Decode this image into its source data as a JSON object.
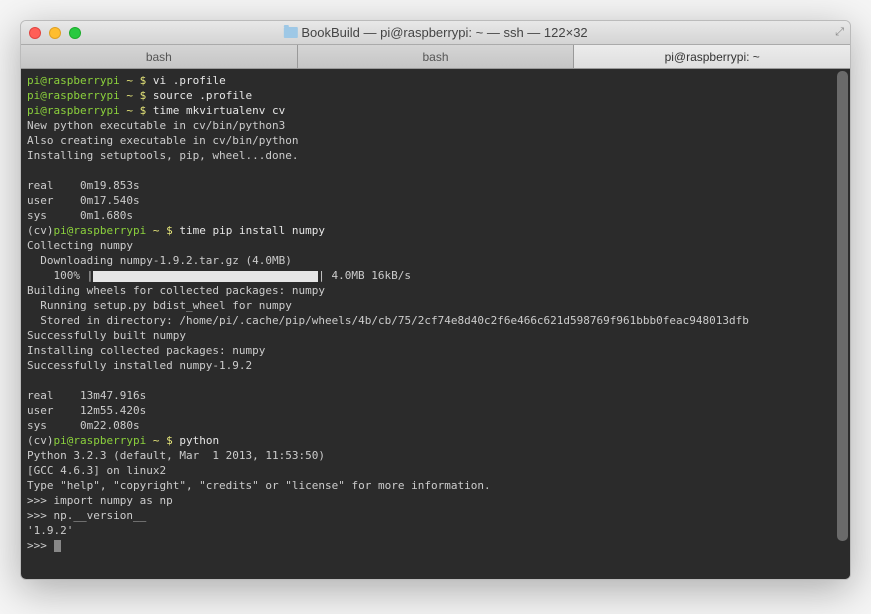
{
  "window": {
    "title": "BookBuild — pi@raspberrypi: ~ — ssh — 122×32"
  },
  "tabs": [
    {
      "label": "bash"
    },
    {
      "label": "bash"
    },
    {
      "label": "pi@raspberrypi: ~"
    }
  ],
  "prompt": {
    "user": "pi@raspberrypi",
    "path": " ~ $ ",
    "venv": "(cv)"
  },
  "cmds": {
    "l1": "vi .profile",
    "l2": "source .profile",
    "l3": "time mkvirtualenv cv",
    "l4": "time pip install numpy",
    "l5": "python"
  },
  "out": {
    "a1": "New python executable in cv/bin/python3",
    "a2": "Also creating executable in cv/bin/python",
    "a3": "Installing setuptools, pip, wheel...done.",
    "t1a": "real    0m19.853s",
    "t1b": "user    0m17.540s",
    "t1c": "sys     0m1.680s",
    "b1": "Collecting numpy",
    "b2": "  Downloading numpy-1.9.2.tar.gz (4.0MB)",
    "b3a": "    100% |",
    "b3b": "| 4.0MB 16kB/s",
    "b4": "Building wheels for collected packages: numpy",
    "b5": "  Running setup.py bdist_wheel for numpy",
    "b6": "  Stored in directory: /home/pi/.cache/pip/wheels/4b/cb/75/2cf74e8d40c2f6e466c621d598769f961bbb0feac948013dfb",
    "b7": "Successfully built numpy",
    "b8": "Installing collected packages: numpy",
    "b9": "Successfully installed numpy-1.9.2",
    "t2a": "real    13m47.916s",
    "t2b": "user    12m55.420s",
    "t2c": "sys     0m22.080s",
    "p1": "Python 3.2.3 (default, Mar  1 2013, 11:53:50)",
    "p2": "[GCC 4.6.3] on linux2",
    "p3": "Type \"help\", \"copyright\", \"credits\" or \"license\" for more information.",
    "p4": ">>> import numpy as np",
    "p5": ">>> np.__version__",
    "p6": "'1.9.2'",
    "p7": ">>> "
  }
}
